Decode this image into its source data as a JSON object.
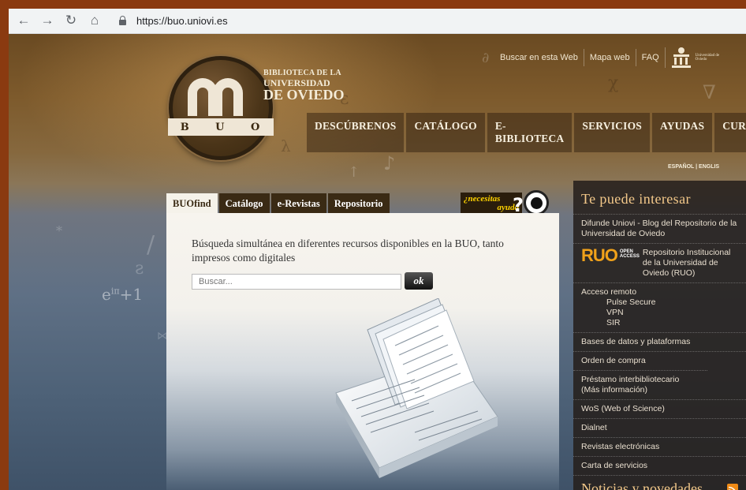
{
  "browser": {
    "url": "https://buo.uniovi.es",
    "back_icon": "arrow-left-icon",
    "forward_icon": "arrow-right-icon",
    "reload_icon": "reload-icon",
    "home_icon": "home-icon",
    "lock_icon": "lock-icon"
  },
  "header": {
    "logo_letters": [
      "B",
      "U",
      "O"
    ],
    "title_line1": "BIBLIOTECA DE LA",
    "title_line2": "UNIVERSIDAD",
    "title_line3": "DE OVIEDO",
    "utility_links": [
      "Buscar en esta Web",
      "Mapa web",
      "FAQ"
    ],
    "university_text": "Universidad de Oviedo",
    "language": "ESPAÑOL | ENGLIS",
    "nav": [
      "DESCÚBRENOS",
      "CATÁLOGO",
      "E-BIBLIOTECA",
      "SERVICIOS",
      "AYUDAS",
      "CURSOS"
    ]
  },
  "search": {
    "tabs": [
      "BUOfind",
      "Catálogo",
      "e-Revistas",
      "Repositorio"
    ],
    "active_tab": "BUOfind",
    "help_line1": "¿necesitas",
    "help_line2": "ayuda",
    "help_mark": "?",
    "description": "Búsqueda simultánea en diferentes recursos disponibles en la BUO, tanto impresos como digitales",
    "placeholder": "Buscar...",
    "button": "ok"
  },
  "sidebar": {
    "title": "Te puede interesar",
    "blog": "Difunde Uniovi - Blog del Repositorio de la Universidad de Oviedo",
    "ruo_logo": "RUO",
    "ruo_badge_line1": "OPEN",
    "ruo_badge_line2": "ACCESS",
    "ruo_text": "Repositorio Institucional de la Universidad de Oviedo (RUO)",
    "remote_title": "Acceso remoto",
    "remote_items": [
      "Pulse Secure",
      "VPN",
      "SIR"
    ],
    "links": [
      "Bases de datos y plataformas",
      "Orden de compra",
      "Préstamo interbibliotecario (Más información)",
      "WoS (Web of Science)",
      "Dialnet",
      "Revistas electrónicas",
      "Carta de servicios"
    ],
    "news_title": "Noticias y novedades",
    "rss_icon": "rss-icon"
  }
}
